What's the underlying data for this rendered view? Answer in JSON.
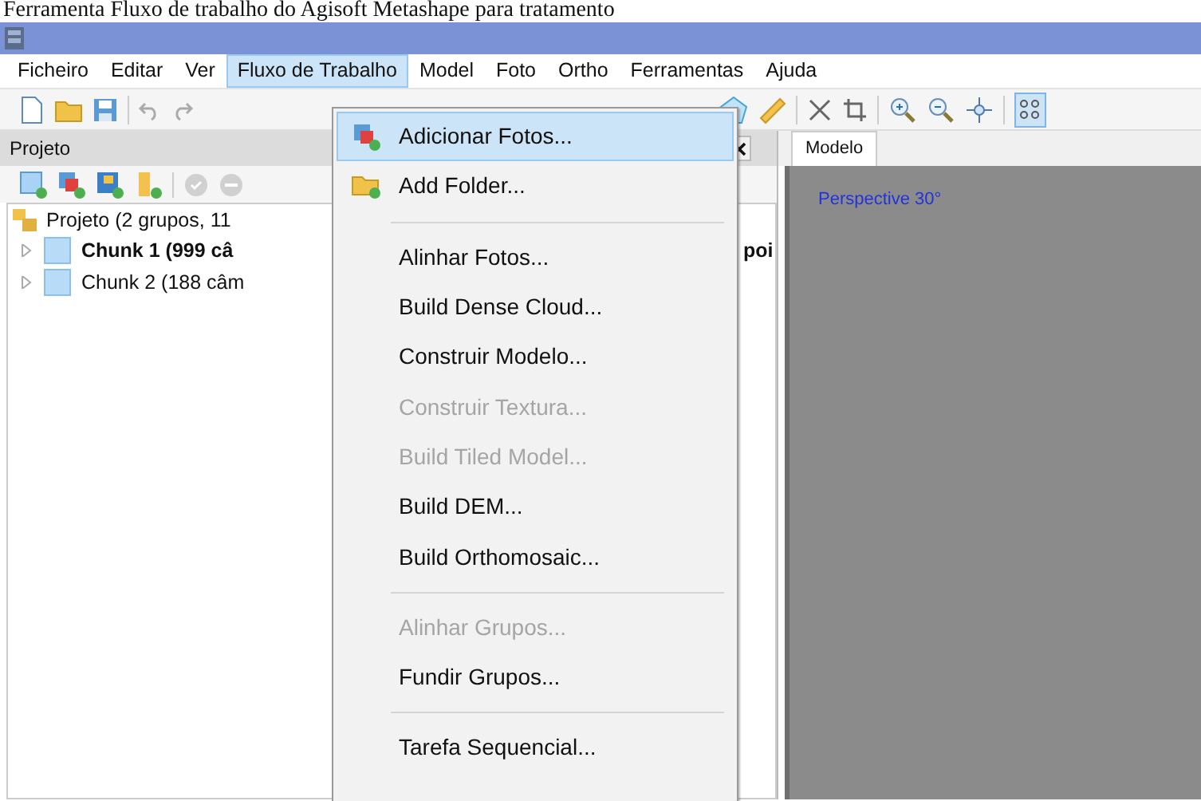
{
  "caption": "Ferramenta Fluxo de trabalho do Agisoft Metashape para tratamento",
  "menu_bar": [
    {
      "label": "Ficheiro",
      "selected": false
    },
    {
      "label": "Editar",
      "selected": false
    },
    {
      "label": "Ver",
      "selected": false
    },
    {
      "label": "Fluxo de Trabalho",
      "selected": true
    },
    {
      "label": "Model",
      "selected": false
    },
    {
      "label": "Foto",
      "selected": false
    },
    {
      "label": "Ortho",
      "selected": false
    },
    {
      "label": "Ferramentas",
      "selected": false
    },
    {
      "label": "Ajuda",
      "selected": false
    }
  ],
  "workflow_menu": [
    {
      "kind": "photos",
      "label": "Adicionar Fotos...",
      "selected": true,
      "disabled": false
    },
    {
      "kind": "folder",
      "label": "Add Folder...",
      "selected": false,
      "disabled": false
    },
    {
      "kind": "separator"
    },
    {
      "kind": "item",
      "label": "Alinhar Fotos...",
      "selected": false,
      "disabled": false
    },
    {
      "kind": "item",
      "label": "Build Dense Cloud...",
      "selected": false,
      "disabled": false
    },
    {
      "kind": "item",
      "label": "Construir Modelo...",
      "selected": false,
      "disabled": false
    },
    {
      "kind": "item",
      "label": "Construir Textura...",
      "selected": false,
      "disabled": true
    },
    {
      "kind": "item",
      "label": "Build Tiled Model...",
      "selected": false,
      "disabled": true
    },
    {
      "kind": "item",
      "label": "Build DEM...",
      "selected": false,
      "disabled": false
    },
    {
      "kind": "item",
      "label": "Build Orthomosaic...",
      "selected": false,
      "disabled": false
    },
    {
      "kind": "separator"
    },
    {
      "kind": "item",
      "label": "Alinhar Grupos...",
      "selected": false,
      "disabled": true
    },
    {
      "kind": "item",
      "label": "Fundir Grupos...",
      "selected": false,
      "disabled": false
    },
    {
      "kind": "separator"
    },
    {
      "kind": "item",
      "label": "Tarefa Sequencial...",
      "selected": false,
      "disabled": false
    }
  ],
  "project_panel": {
    "title": "Projeto",
    "tree": [
      {
        "label": "Projeto (2 grupos, 11",
        "children": [
          {
            "label": "Chunk 1 (999 câ",
            "tail": "poi",
            "bold": true,
            "expanded": false
          },
          {
            "label": "Chunk 2 (188 câm",
            "bold": false,
            "expanded": false
          }
        ]
      }
    ]
  },
  "view_tab": {
    "label": "Modelo"
  },
  "viewport": {
    "overlay": "Perspective 30°"
  }
}
